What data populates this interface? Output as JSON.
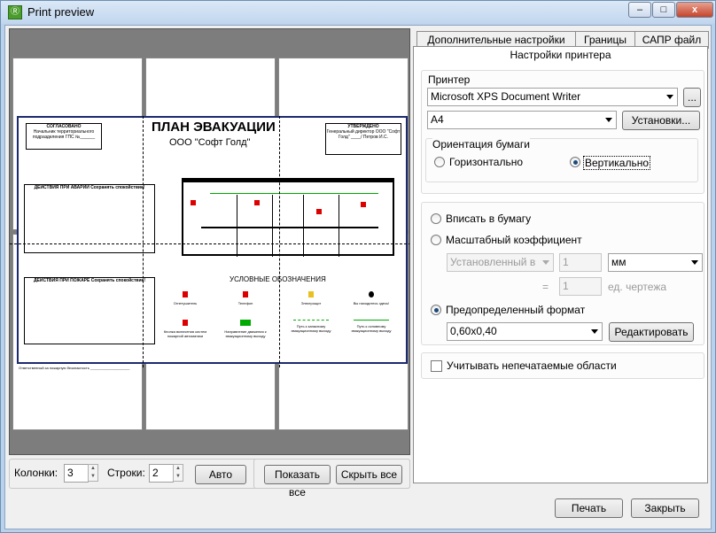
{
  "window": {
    "title": "Print preview",
    "minimize": "–",
    "maximize": "□",
    "close": "x"
  },
  "tabs": [
    {
      "label": "Дополнительные настройки"
    },
    {
      "label": "Границы"
    },
    {
      "label": "САПР файл"
    },
    {
      "label": "Настройки принтера"
    }
  ],
  "printer": {
    "group_label": "Принтер",
    "name": "Microsoft XPS Document Writer",
    "browse": "...",
    "paper": "A4",
    "setup_button": "Установки...",
    "orientation_label": "Ориентация бумаги",
    "landscape": "Горизонтально",
    "portrait": "Вертикально"
  },
  "scale": {
    "fit": "Вписать в бумагу",
    "factor": "Масштабный коэффициент",
    "mode": "Установленный в",
    "value1": "1",
    "unit": "мм",
    "eq": "=",
    "value2": "1",
    "drawing_units": "ед. чертежа",
    "predefined": "Предопределенный формат",
    "format": "0,60x0,40",
    "edit_button": "Редактировать"
  },
  "nonprint": {
    "label": "Учитывать непечатаемые области"
  },
  "layout": {
    "columns_label": "Колонки:",
    "columns_value": "3",
    "rows_label": "Строки:",
    "rows_value": "2",
    "auto": "Авто",
    "show_all": "Показать все",
    "hide_all": "Скрыть все"
  },
  "footer": {
    "print": "Печать",
    "close": "Закрыть"
  },
  "plan": {
    "title": "ПЛАН ЭВАКУАЦИИ",
    "company": "ООО \"Софт Голд\"",
    "agreed": "СОГЛАСОВАНО",
    "approved": "УТВЕРЖДЕНО",
    "agreed_text": "Начальник территориального подразделения ГПС №______",
    "approved_text": "Генеральный директор ООО \"Софт Голд\" ____/ Петров И.С.",
    "accident": "ДЕЙСТВИЯ ПРИ АВАРИИ Сохранять спокойствие!",
    "fire": "ДЕЙСТВИЯ ПРИ ПОЖАРЕ Сохранять спокойствие!",
    "legend_title": "УСЛОВНЫЕ ОБОЗНАЧЕНИЯ",
    "responsible": "Ответственный за пожарную безопасность ____________________",
    "legend": [
      "Огнетушитель",
      "Телефон",
      "Электрощит",
      "Вы находитесь здесь!",
      "Кнопка включения систем пожарной автоматики",
      "Направление движения к эвакуационному выходу",
      "Путь к запасному эвакуационному выходу",
      "Путь к основному эвакуационному выходу"
    ]
  }
}
